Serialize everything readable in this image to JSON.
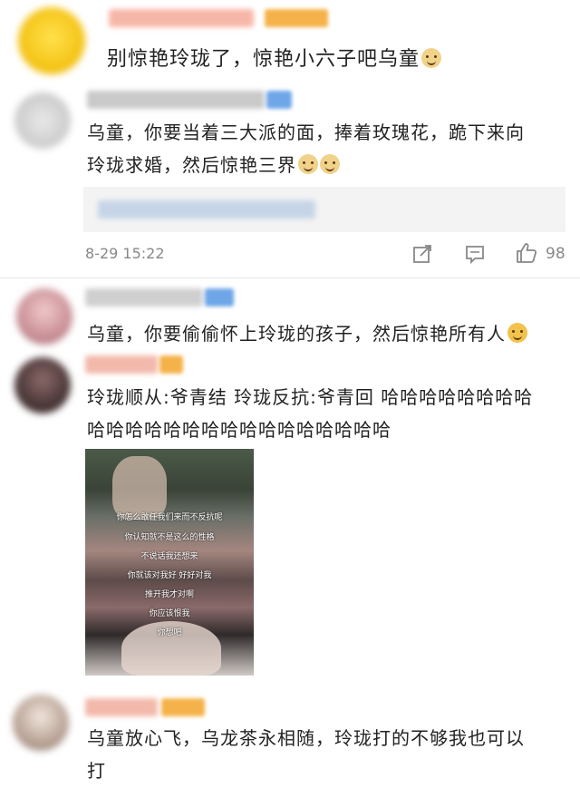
{
  "top_comment": {
    "text": "别惊艳玲珑了，惊艳小六子吧乌童",
    "emoji": "doge-emoji"
  },
  "reply_1": {
    "text_line1": "乌童，你要当着三大派的面，捧着玫瑰花，跪下来向",
    "text_line2": "玲珑求婚，然后惊艳三界",
    "time": "8-29 15:22",
    "likes": "98"
  },
  "reply_2": {
    "text": "乌童，你要偷偷怀上玲珑的孩子，然后惊艳所有人"
  },
  "reply_3": {
    "text_line1": "玲珑顺从:爷青结  玲珑反抗:爷青回 哈哈哈哈哈哈哈哈",
    "text_line2": "哈哈哈哈哈哈哈哈哈哈哈哈哈哈哈哈",
    "image_captions": [
      "你怎么敢任我们来而不反抗呢",
      "你认知就不是这么的性格",
      "不说话我还想来",
      "你就该对我好 好好对我",
      "推开我才对啊",
      "你应该恨我",
      "你想吧"
    ]
  },
  "reply_4": {
    "text_line1": "乌童放心飞，乌龙茶永相随，玲珑打的不够我也可以",
    "text_line2": "打"
  },
  "colors": {
    "badge": "#f5b24a",
    "blue_badge": "#6ea6e8",
    "icon": "#888888",
    "divider": "#e6e6e6"
  }
}
